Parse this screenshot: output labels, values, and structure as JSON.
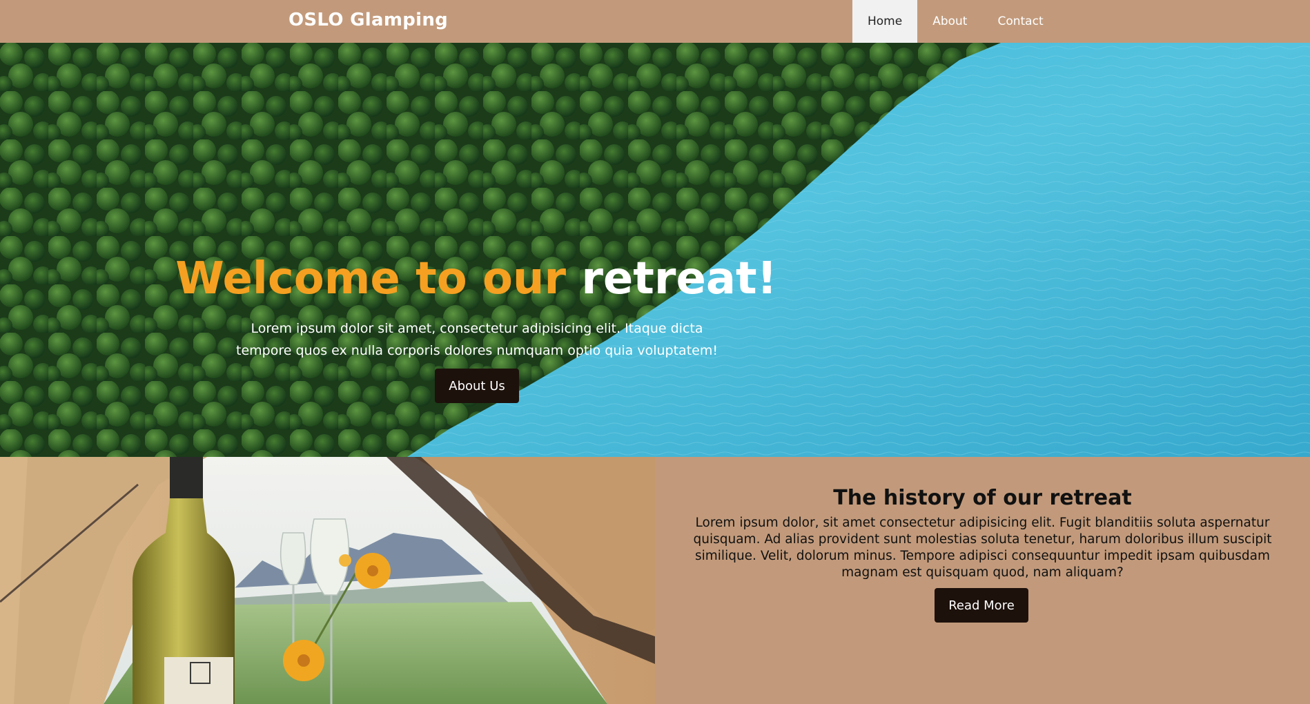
{
  "header": {
    "brand": "OSLO Glamping",
    "nav": [
      {
        "label": "Home",
        "active": true
      },
      {
        "label": "About",
        "active": false
      },
      {
        "label": "Contact",
        "active": false
      }
    ]
  },
  "hero": {
    "title_accent": "Welcome to our",
    "title_rest": "retreat!",
    "subtitle": "Lorem ipsum dolor sit amet, consectetur adipisicing elit. Itaque dicta tempore quos ex nulla corporis dolores numquam optio quia voluptatem!",
    "button_label": "About Us"
  },
  "history": {
    "title": "The history of our retreat",
    "body": "Lorem ipsum dolor, sit amet consectetur adipisicing elit. Fugit blanditiis soluta aspernatur quisquam. Ad alias provident sunt molestias soluta tenetur, harum doloribus illum suscipit similique. Velit, dolorum minus. Tempore adipisci consequuntur impedit ipsam quibusdam magnam est quisquam quod, nam aliquam?",
    "button_label": "Read More"
  },
  "colors": {
    "header_bg": "#c29a7b",
    "accent_orange": "#f5a021",
    "button_dark": "#1d110c",
    "nav_active_bg": "#f1f1f1"
  }
}
